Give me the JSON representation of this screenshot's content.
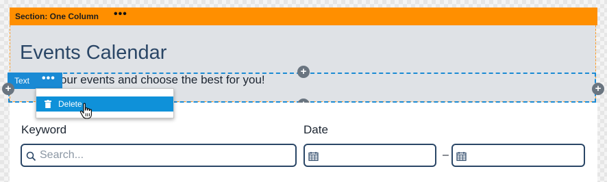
{
  "section": {
    "label": "Section: One Column",
    "menu_icon": "more-dots-icon"
  },
  "hero": {
    "title": "Events Calendar"
  },
  "text_block": {
    "chip_label": "Text",
    "content": "our events and choose the best for you!"
  },
  "context_menu": {
    "items": [
      {
        "label": "Delete",
        "icon": "trash-icon"
      }
    ]
  },
  "add_buttons": {
    "symbol": "+"
  },
  "form": {
    "keyword_label": "Keyword",
    "keyword_placeholder": "Search...",
    "date_label": "Date",
    "date_separator": "–"
  },
  "colors": {
    "section_bar": "#ff8f00",
    "selection_blue": "#1a8ad4",
    "title_navy": "#2a4666"
  }
}
